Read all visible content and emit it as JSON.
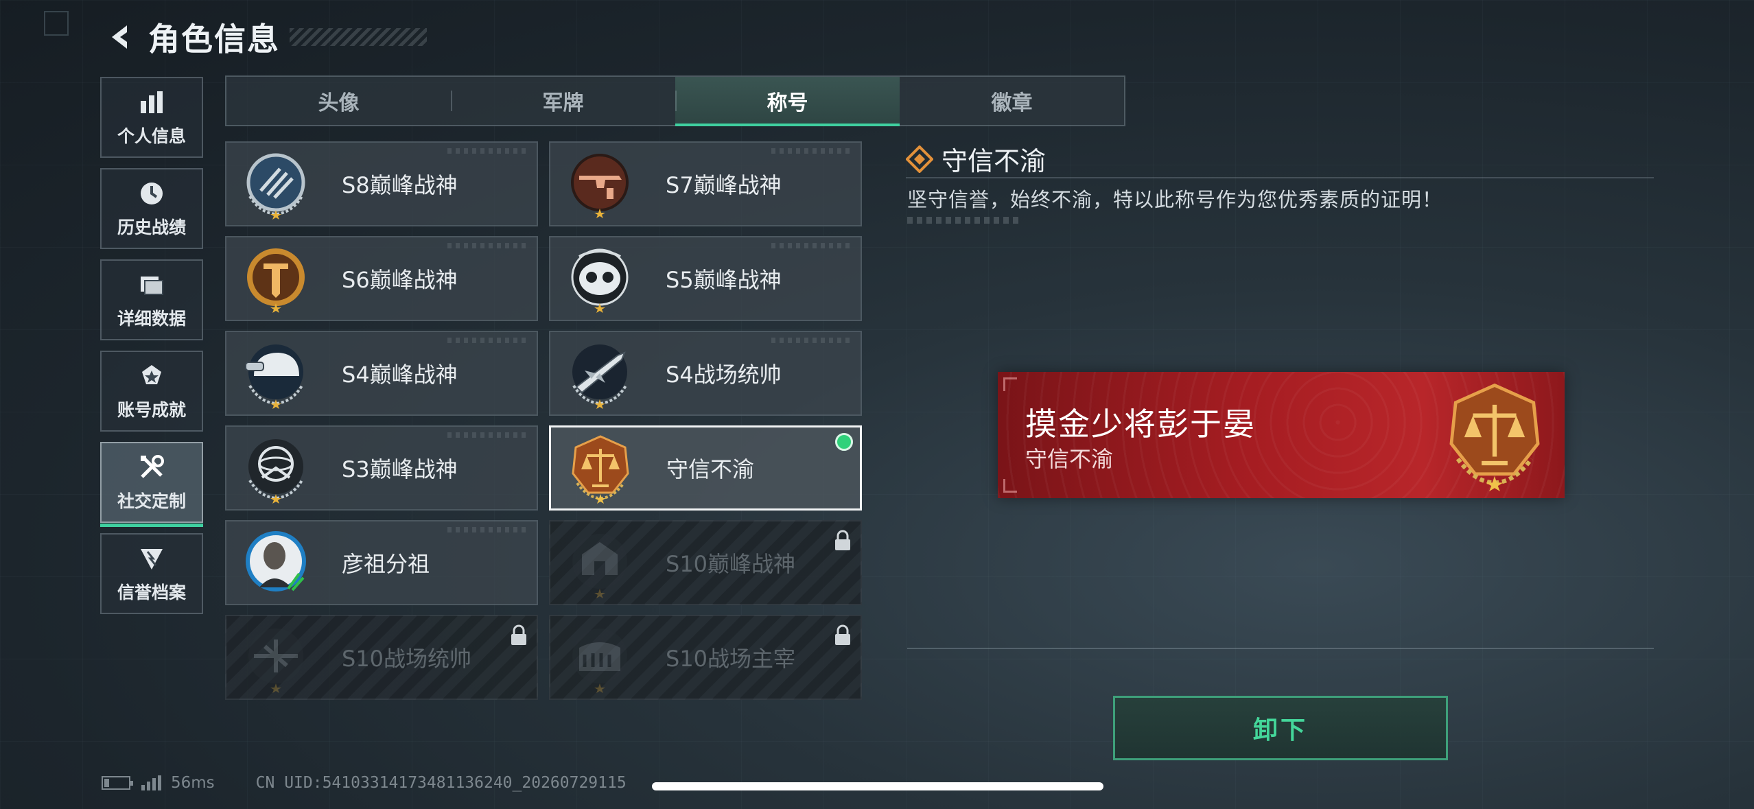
{
  "header": {
    "title": "角色信息"
  },
  "sidebar": {
    "items": [
      {
        "label": "个人信息",
        "icon": "bar-chart-icon",
        "active": false
      },
      {
        "label": "历史战绩",
        "icon": "clock-icon",
        "active": false
      },
      {
        "label": "详细数据",
        "icon": "folder-icon",
        "active": false
      },
      {
        "label": "账号成就",
        "icon": "medal-icon",
        "active": false
      },
      {
        "label": "社交定制",
        "icon": "tools-icon",
        "active": true
      },
      {
        "label": "信誉档案",
        "icon": "shield-badge-icon",
        "active": false
      }
    ]
  },
  "tabs": [
    {
      "label": "头像",
      "active": false
    },
    {
      "label": "军牌",
      "active": false
    },
    {
      "label": "称号",
      "active": true
    },
    {
      "label": "徽章",
      "active": false
    }
  ],
  "titles": [
    {
      "label": "S8巅峰战神",
      "badge": "s8-emblem",
      "state": "owned"
    },
    {
      "label": "S7巅峰战神",
      "badge": "s7-emblem",
      "state": "owned"
    },
    {
      "label": "S6巅峰战神",
      "badge": "s6-emblem",
      "state": "owned"
    },
    {
      "label": "S5巅峰战神",
      "badge": "s5-emblem",
      "state": "owned"
    },
    {
      "label": "S4巅峰战神",
      "badge": "s4-helmet-emblem",
      "state": "owned"
    },
    {
      "label": "S4战场统帅",
      "badge": "s4-missile-emblem",
      "state": "owned"
    },
    {
      "label": "S3巅峰战神",
      "badge": "s3-globe-emblem",
      "state": "owned"
    },
    {
      "label": "守信不渝",
      "badge": "scales-emblem",
      "state": "equipped"
    },
    {
      "label": "彦祖分祖",
      "badge": "portrait-emblem",
      "state": "owned"
    },
    {
      "label": "S10巅峰战神",
      "badge": "s10-building-emblem",
      "state": "locked"
    },
    {
      "label": "S10战场统帅",
      "badge": "s10-aircraft-emblem",
      "state": "locked"
    },
    {
      "label": "S10战场主宰",
      "badge": "s10-colosseum-emblem",
      "state": "locked"
    }
  ],
  "detail": {
    "title": "守信不渝",
    "description": "坚守信誉，始终不渝，特以此称号作为您优秀素质的证明！"
  },
  "plate": {
    "name": "摸金少将彭于晏",
    "title": "守信不渝"
  },
  "action": {
    "unequip_label": "卸下"
  },
  "status": {
    "ping": "56ms",
    "uid": "CN UID:541033141734811362​40_20260729115",
    "battery_level": 0.2
  },
  "colors": {
    "accent": "#3fd0a0",
    "equipped": "#2fd17a",
    "plate_red": "#a61d22",
    "button_text": "#44d69a"
  }
}
